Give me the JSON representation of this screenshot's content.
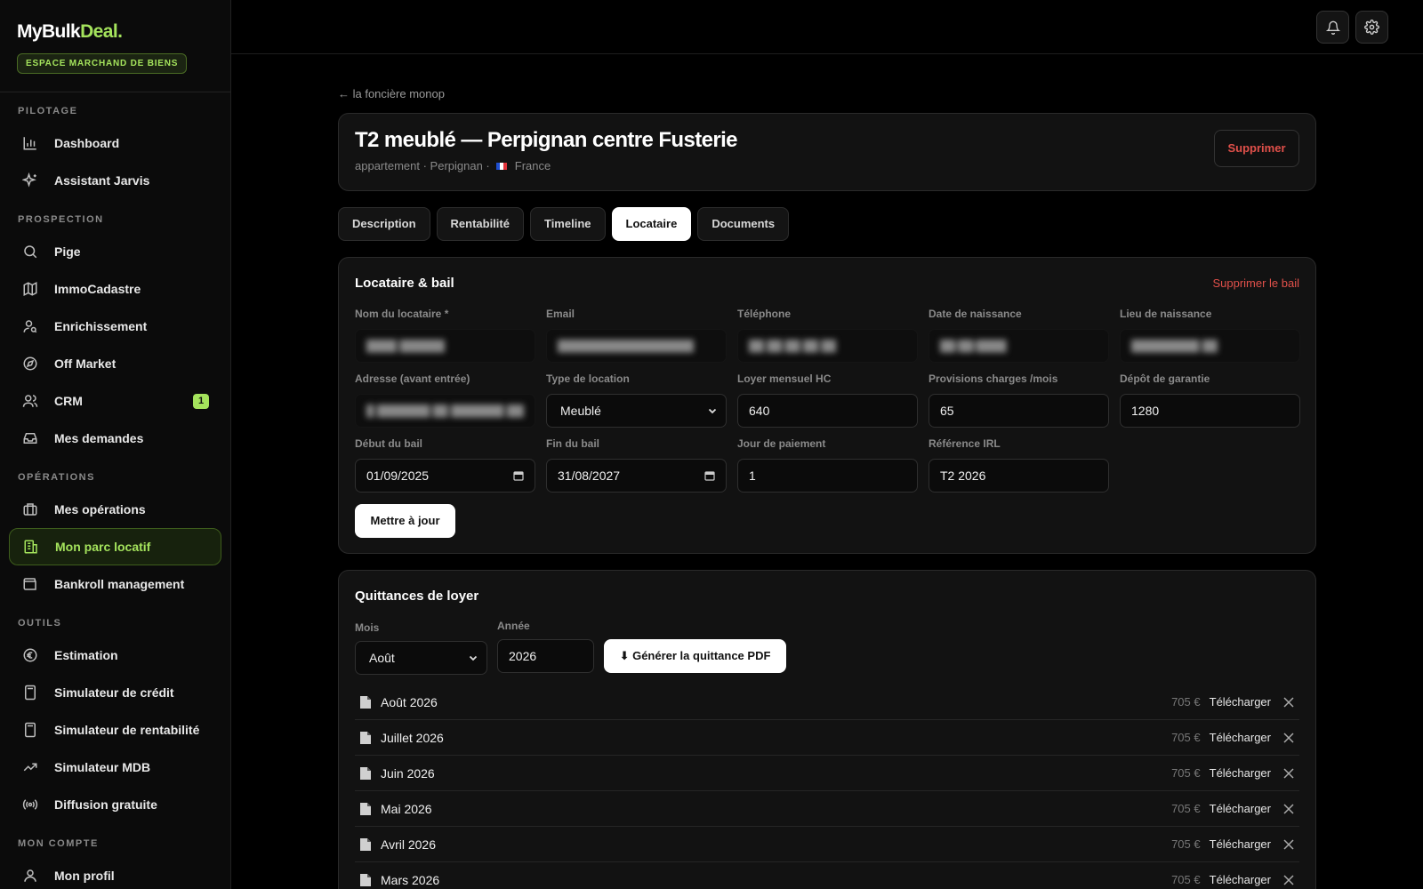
{
  "brand": {
    "logo_part1": "MyBulk",
    "logo_part2": "Deal",
    "logo_dot": ".",
    "space_badge": "ESPACE MARCHAND DE BIENS"
  },
  "sidebar": {
    "sections": {
      "pilotage": "PILOTAGE",
      "prospection": "PROSPECTION",
      "operations": "OPÉRATIONS",
      "outils": "OUTILS",
      "mon_compte": "MON COMPTE"
    },
    "items": {
      "dashboard": "Dashboard",
      "jarvis": "Assistant Jarvis",
      "pige": "Pige",
      "immocadastre": "ImmoCadastre",
      "enrichissement": "Enrichissement",
      "off_market": "Off Market",
      "crm": "CRM",
      "crm_count": "1",
      "mes_demandes": "Mes demandes",
      "mes_operations": "Mes opérations",
      "parc_locatif": "Mon parc locatif",
      "bankroll": "Bankroll management",
      "estimation": "Estimation",
      "sim_credit": "Simulateur de crédit",
      "sim_rentabilite": "Simulateur de rentabilité",
      "sim_mdb": "Simulateur MDB",
      "diffusion": "Diffusion gratuite",
      "mon_profil": "Mon profil"
    }
  },
  "header": {
    "back_link": "← la foncière monop",
    "title": "T2 meublé — Perpignan centre Fusterie",
    "subtitle_type": "appartement · Perpignan ·",
    "subtitle_country": "France",
    "delete_label": "Supprimer"
  },
  "tabs": [
    "Description",
    "Rentabilité",
    "Timeline",
    "Locataire",
    "Documents"
  ],
  "lease": {
    "title": "Locataire & bail",
    "delete_lease": "Supprimer le bail",
    "labels": {
      "nom": "Nom du locataire *",
      "email": "Email",
      "telephone": "Téléphone",
      "naissance_date": "Date de naissance",
      "naissance_lieu": "Lieu de naissance",
      "adresse": "Adresse (avant entrée)",
      "type": "Type de location",
      "loyer": "Loyer mensuel HC",
      "charges": "Provisions charges /mois",
      "depot": "Dépôt de garantie",
      "debut": "Début du bail",
      "fin": "Fin du bail",
      "jour": "Jour de paiement",
      "irl": "Référence IRL"
    },
    "values": {
      "type": "Meublé",
      "loyer": "640",
      "charges": "65",
      "depot": "1280",
      "debut": "01/09/2025",
      "fin": "31/08/2027",
      "jour": "1",
      "irl": "T2 2026"
    },
    "update_button": "Mettre à jour"
  },
  "receipts": {
    "title": "Quittances de loyer",
    "mois_label": "Mois",
    "annee_label": "Année",
    "mois_value": "Août",
    "annee_value": "2026",
    "generate_button": "⬇ Générer la quittance PDF",
    "download_label": "Télécharger",
    "rows": [
      {
        "name": "Août 2026",
        "amount": "705 €"
      },
      {
        "name": "Juillet 2026",
        "amount": "705 €"
      },
      {
        "name": "Juin 2026",
        "amount": "705 €"
      },
      {
        "name": "Mai 2026",
        "amount": "705 €"
      },
      {
        "name": "Avril 2026",
        "amount": "705 €"
      },
      {
        "name": "Mars 2026",
        "amount": "705 €"
      }
    ]
  },
  "colors": {
    "accent": "#a4e35c",
    "danger": "#e0504a",
    "background": "#000000",
    "card": "#121212"
  },
  "icons": {
    "notifications": "bell-icon",
    "settings": "gear-icon"
  }
}
